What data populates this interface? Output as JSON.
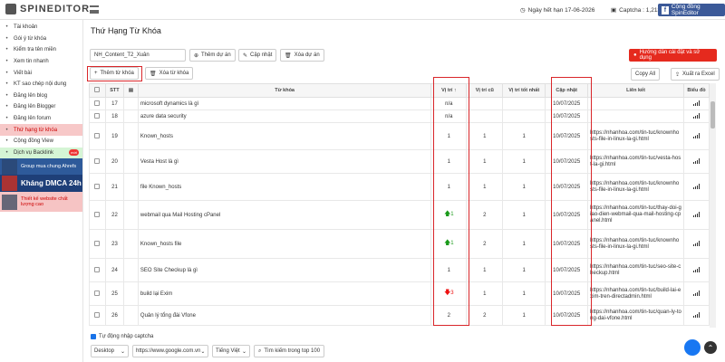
{
  "brand": "SPINEDITOR",
  "header": {
    "expiry": "Ngày hết hạn 17-06-2026",
    "captcha": "Captcha : 1,213",
    "community": "Cộng đồng SpinEditor"
  },
  "sidebar": {
    "items": [
      {
        "label": "Tài khoản",
        "icon": "user-icon"
      },
      {
        "label": "Gói ý từ khóa",
        "icon": "star-icon"
      },
      {
        "label": "Kiểm tra tên miền",
        "icon": "check-icon"
      },
      {
        "label": "Xem tin nhanh",
        "icon": "eye-icon"
      },
      {
        "label": "Viết bài",
        "icon": "pencil-icon"
      },
      {
        "label": "KT sao chép nội dung",
        "icon": "copy-icon"
      },
      {
        "label": "Đăng lên blog",
        "icon": "upload-icon"
      },
      {
        "label": "Đăng lên Blogger",
        "icon": "upload-icon"
      },
      {
        "label": "Đăng lên forum",
        "icon": "upload-icon"
      },
      {
        "label": "Thứ hạng từ khóa",
        "icon": "search-icon"
      },
      {
        "label": "Cộng đồng View",
        "icon": "refresh-icon"
      },
      {
        "label": "Dịch vụ Backlink",
        "icon": "link-icon",
        "badge": "mới"
      }
    ],
    "banners": [
      {
        "label": "Group mua chung Ahrefs"
      },
      {
        "label": "Kháng DMCA 24h"
      },
      {
        "label": "Thiết kế website chất lượng cao"
      }
    ]
  },
  "page": {
    "title": "Thứ Hạng Từ Khóa",
    "project_value": "NH_Content_T2_Xuân",
    "add_project": "Thêm dự án",
    "update": "Cập nhật",
    "delete_project": "Xóa dự án",
    "guide": "Hướng dẫn cài đặt và sử dụng",
    "add_keyword": "Thêm từ khóa",
    "delete_keyword": "Xóa từ khóa",
    "copy_all": "Copy All",
    "export_excel": "Xuất ra Excel"
  },
  "table": {
    "headers": {
      "stt": "STT",
      "keyword": "Từ khóa",
      "pos": "Vị trí",
      "old": "Vị trí cũ",
      "best": "Vị trí tốt nhất",
      "updated": "Cập nhật",
      "link": "Liên kết",
      "chart": "Biểu đồ"
    },
    "rows": [
      {
        "stt": "17",
        "kw": "microsoft dynamics là gì",
        "pos": "n/a",
        "dir": "",
        "old": "",
        "best": "",
        "date": "10/07/2025",
        "link": ""
      },
      {
        "stt": "18",
        "kw": "azure data security",
        "pos": "n/a",
        "dir": "",
        "old": "",
        "best": "",
        "date": "10/07/2025",
        "link": ""
      },
      {
        "stt": "19",
        "kw": "Known_hosts",
        "pos": "1",
        "dir": "",
        "old": "1",
        "best": "1",
        "date": "10/07/2025",
        "link": "https://nhanhoa.com/tin-tuc/knownhosts-file-in-linux-la-gi.html"
      },
      {
        "stt": "20",
        "kw": "Vesta Host là gì",
        "pos": "1",
        "dir": "",
        "old": "1",
        "best": "1",
        "date": "10/07/2025",
        "link": "https://nhanhoa.com/tin-tuc/vesta-host-la-gi.html"
      },
      {
        "stt": "21",
        "kw": "file Known_hosts",
        "pos": "1",
        "dir": "",
        "old": "1",
        "best": "1",
        "date": "10/07/2025",
        "link": "https://nhanhoa.com/tin-tuc/knownhosts-file-in-linux-la-gi.html"
      },
      {
        "stt": "22",
        "kw": "webmail qua Mail Hosting cPanel",
        "pos": "1",
        "dir": "up",
        "old": "2",
        "best": "1",
        "date": "10/07/2025",
        "link": "https://nhanhoa.com/tin-tuc/thay-doi-giao-dien-webmail-qua-mail-hosting-cpanel.html"
      },
      {
        "stt": "23",
        "kw": "Known_hosts file",
        "pos": "1",
        "dir": "up",
        "old": "2",
        "best": "1",
        "date": "10/07/2025",
        "link": "https://nhanhoa.com/tin-tuc/knownhosts-file-in-linux-la-gi.html"
      },
      {
        "stt": "24",
        "kw": "SEO Site Checkup là gì",
        "pos": "1",
        "dir": "",
        "old": "1",
        "best": "1",
        "date": "10/07/2025",
        "link": "https://nhanhoa.com/tin-tuc/seo-site-checkup.html"
      },
      {
        "stt": "25",
        "kw": "build lại Exim",
        "pos": "3",
        "dir": "down",
        "old": "1",
        "best": "1",
        "date": "10/07/2025",
        "link": "https://nhanhoa.com/tin-tuc/build-lai-exim-tren-directadmin.html"
      },
      {
        "stt": "26",
        "kw": "Quản lý tổng đài Vfone",
        "pos": "2",
        "dir": "",
        "old": "2",
        "best": "1",
        "date": "10/07/2025",
        "link": "https://nhanhoa.com/tin-tuc/quan-ly-tong-dai-vfone.html"
      }
    ]
  },
  "footer": {
    "auto_captcha": "Tự động nhập captcha",
    "device": "Desktop",
    "engine": "https://www.google.com.vn",
    "language": "Tiếng Việt",
    "search_top": "Tìm kiếm trong top 100"
  },
  "colors": {
    "accent_red": "#e52a1e",
    "active_bg": "#f7c8c8",
    "highlight": "#d9262a"
  }
}
